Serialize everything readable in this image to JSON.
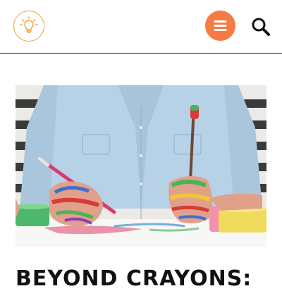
{
  "header": {
    "logo_icon": "lightbulb-icon",
    "menu_icon": "hamburger-menu-icon",
    "search_icon": "search-icon",
    "accent_color": "#f47b46",
    "logo_color": "#f0a03a"
  },
  "article": {
    "hero_image": "child-hands-covered-in-paint-holding-paintbrushes",
    "title": "BEYOND CRAYONS:"
  }
}
